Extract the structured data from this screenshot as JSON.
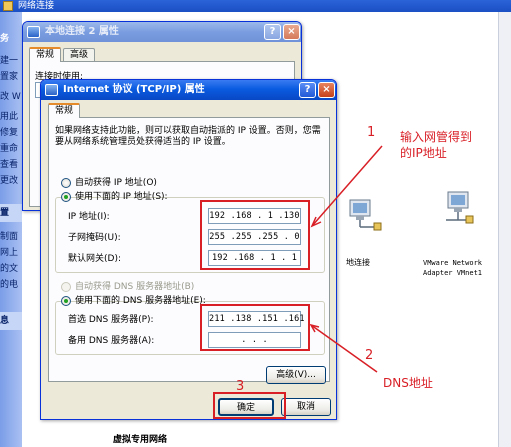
{
  "background": {
    "window_title": "网络连接",
    "left_pane": {
      "items_top": [
        "务",
        "建一",
        "置家",
        "改 W",
        "用此",
        "修复",
        "重命",
        "查看",
        "更改"
      ],
      "section_heading": "置",
      "items_bottom": [
        "制面",
        "网上",
        "的文",
        "的电"
      ],
      "section_heading2": "息"
    },
    "connections": [
      {
        "label": "地连接"
      },
      {
        "label_line1": "VMware Network",
        "label_line2": "Adapter VMnet1"
      }
    ],
    "bottom_heading": "虚拟专用网络"
  },
  "conn_properties": {
    "title": "本地连接 2 属性",
    "tabs": [
      "常规",
      "高级"
    ],
    "connect_using_label": "连接时使用:",
    "title_buttons": [
      "?",
      "×"
    ]
  },
  "tcpip": {
    "title": "Internet 协议 (TCP/IP) 属性",
    "title_buttons": [
      "?",
      "×"
    ],
    "tab": "常规",
    "description": "如果网络支持此功能，则可以获取自动指派的 IP 设置。否则，您需要从网络系统管理员处获得适当的 IP 设置。",
    "auto_ip": "自动获得 IP 地址(O)",
    "manual_ip": "使用下面的 IP 地址(S):",
    "ip_label": "IP 地址(I):",
    "ip_value": "192 .168 . 1  .130",
    "mask_label": "子网掩码(U):",
    "mask_value": "255 .255 .255 . 0",
    "gateway_label": "默认网关(D):",
    "gateway_value": "192 .168 . 1  . 1",
    "auto_dns": "自动获得 DNS 服务器地址(B)",
    "manual_dns": "使用下面的 DNS 服务器地址(E):",
    "pref_dns_label": "首选 DNS 服务器(P):",
    "pref_dns_value": "211 .138 .151 .161",
    "alt_dns_label": "备用 DNS 服务器(A):",
    "alt_dns_value": ".     .     .",
    "advanced_button": "高级(V)...",
    "ok_button": "确定",
    "cancel_button": "取消"
  },
  "annotations": {
    "num1": "1",
    "text1_line1": "输入网管得到",
    "text1_line2": "的IP地址",
    "num2": "2",
    "text2": "DNS地址",
    "num3": "3",
    "color": "#d81f26"
  }
}
